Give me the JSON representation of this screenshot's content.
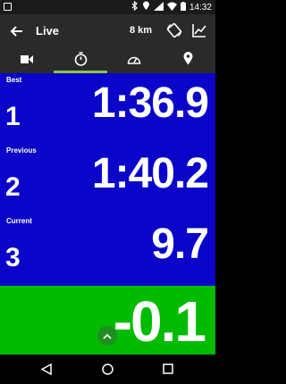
{
  "status": {
    "time": "14:32"
  },
  "toolbar": {
    "title": "Live",
    "distance": "8 km"
  },
  "tabs": [
    {
      "name": "video"
    },
    {
      "name": "stopwatch",
      "active": true
    },
    {
      "name": "speedometer"
    },
    {
      "name": "location"
    }
  ],
  "laps": [
    {
      "label": "Best",
      "index": "1",
      "value": "1:36.9"
    },
    {
      "label": "Previous",
      "index": "2",
      "value": "1:40.2"
    },
    {
      "label": "Current",
      "index": "3",
      "value": "9.7"
    }
  ],
  "delta": {
    "value": "-0.1"
  },
  "colors": {
    "panel": "#0a05c9",
    "delta": "#00bb00",
    "accent": "#8bc34a"
  }
}
